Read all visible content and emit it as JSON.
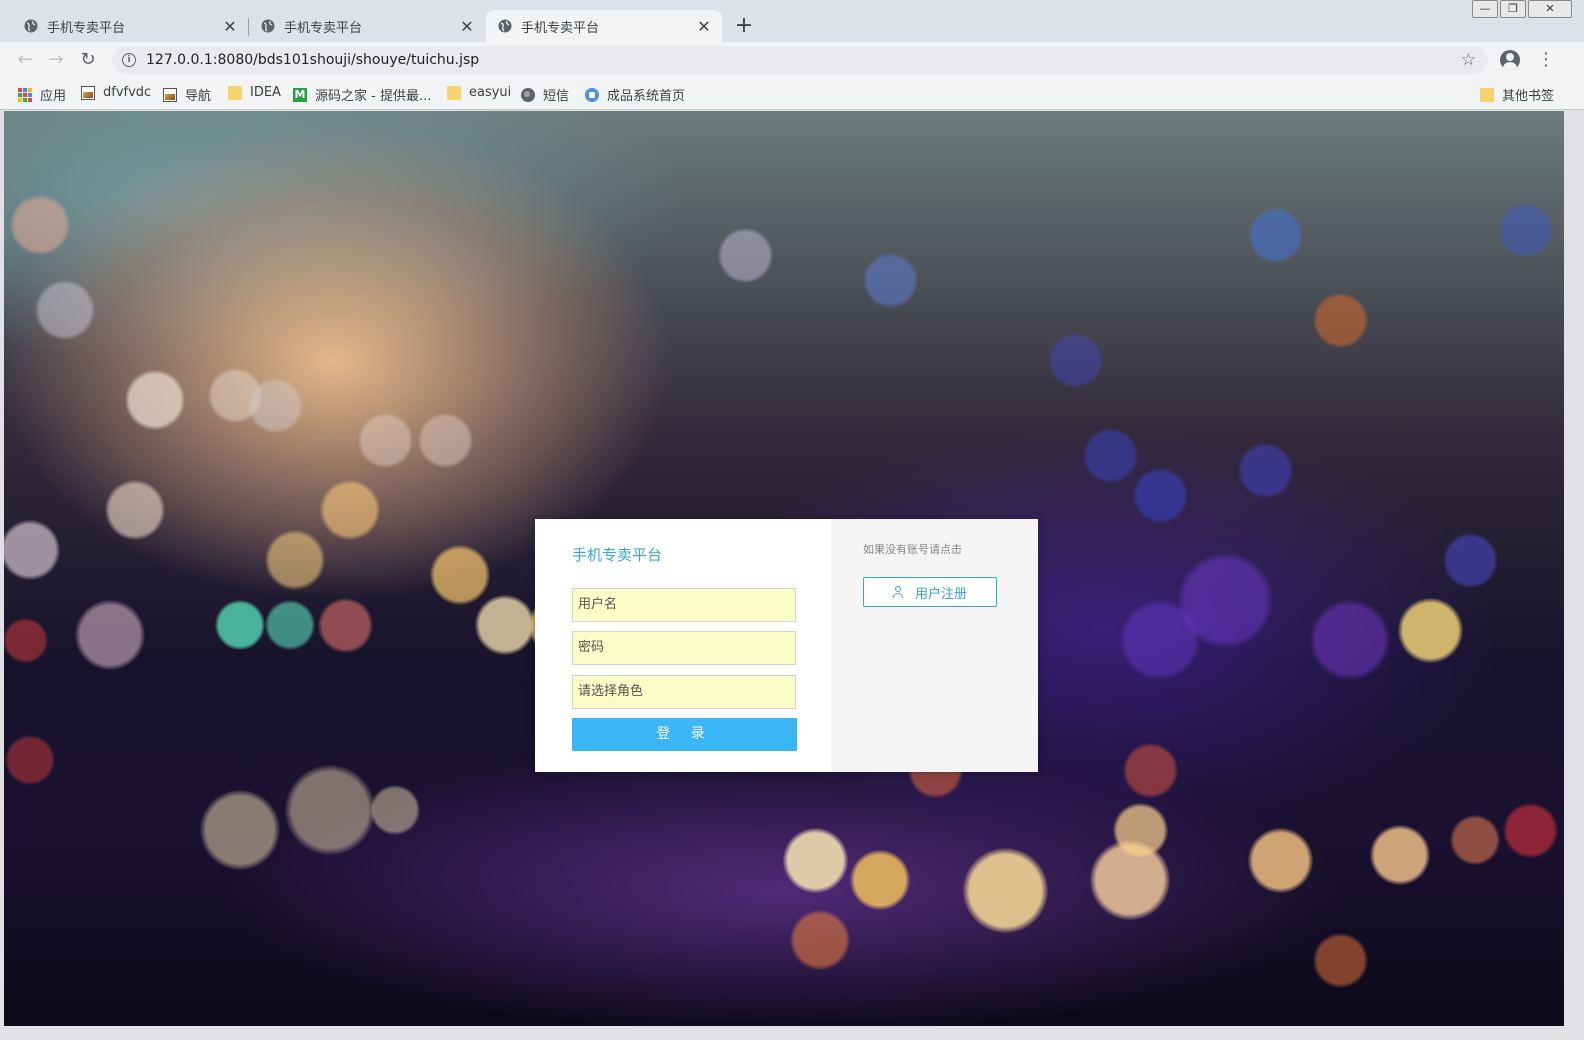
{
  "browser": {
    "tabs": [
      {
        "title": "手机专卖平台",
        "active": false
      },
      {
        "title": "手机专卖平台",
        "active": false
      },
      {
        "title": "手机专卖平台",
        "active": true
      }
    ],
    "new_tab_symbol": "+",
    "url": "127.0.0.1:8080/bds101shouji/shouye/tuichu.jsp",
    "bookmarks": [
      {
        "label": "应用",
        "icon": "apps-grid-icon"
      },
      {
        "label": "dfvfvdc",
        "icon": "image-icon"
      },
      {
        "label": "导航",
        "icon": "image-icon"
      },
      {
        "label": "IDEA",
        "icon": "folder-icon"
      },
      {
        "label": "源码之家 - 提供最...",
        "icon": "m-logo-icon"
      },
      {
        "label": "easyui",
        "icon": "folder-icon"
      },
      {
        "label": "短信",
        "icon": "globe-icon"
      },
      {
        "label": "成品系统首页",
        "icon": "home-icon"
      }
    ],
    "other_bookmarks": "其他书签"
  },
  "login": {
    "title": "手机专卖平台",
    "username_placeholder": "用户名",
    "password_placeholder": "密码",
    "role_placeholder": "请选择角色",
    "login_button": "登 录",
    "register_hint": "如果没有账号请点击",
    "register_button": "用户注册"
  },
  "colors": {
    "accent": "#3aa3e3",
    "login_button_bg": "#3cb5f5",
    "input_bg": "#fafdc6"
  }
}
